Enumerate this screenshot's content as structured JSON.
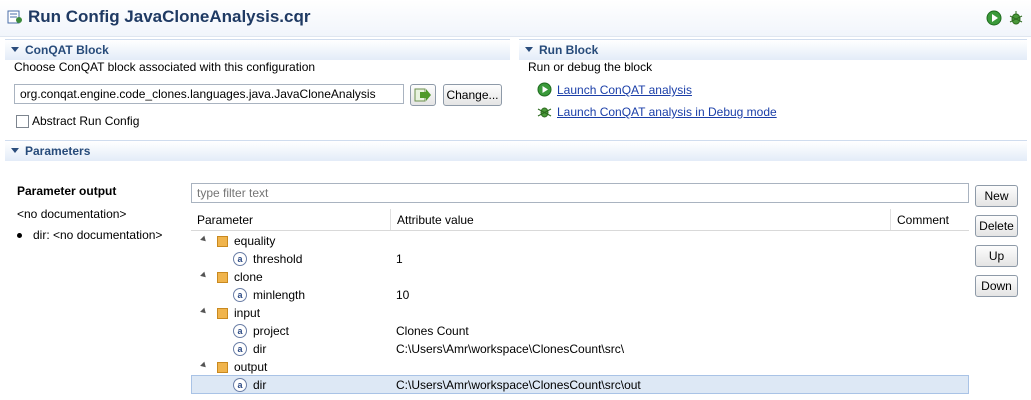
{
  "editor": {
    "title": "Run Config JavaCloneAnalysis.cqr",
    "title_icon": "config-icon",
    "toolbar_icons": [
      "run-icon",
      "debug-icon"
    ]
  },
  "conqat_block": {
    "header": "ConQAT Block",
    "description": "Choose ConQAT block associated with this configuration",
    "block_value": "org.conqat.engine.code_clones.languages.java.JavaCloneAnalysis",
    "go_icon": "arrow-right-icon",
    "change_label": "Change...",
    "abstract_label": "Abstract Run Config"
  },
  "run_block": {
    "header": "Run Block",
    "description": "Run or debug the block",
    "launch_label": "Launch ConQAT analysis",
    "launch_debug_label": "Launch ConQAT analysis in Debug mode"
  },
  "parameters": {
    "header": "Parameters",
    "doc_title": "Parameter output",
    "doc_text": "<no documentation>",
    "doc_bullet": "dir: <no documentation>",
    "filter_placeholder": "type filter text",
    "columns": [
      "Parameter",
      "Attribute value",
      "Comment"
    ],
    "buttons": {
      "new": "New",
      "delete": "Delete",
      "up": "Up",
      "down": "Down"
    },
    "attr_glyph": "a",
    "rows": [
      {
        "name": "equality",
        "value": ""
      },
      {
        "name": "threshold",
        "value": "1"
      },
      {
        "name": "clone",
        "value": ""
      },
      {
        "name": "minlength",
        "value": "10"
      },
      {
        "name": "input",
        "value": ""
      },
      {
        "name": "project",
        "value": "Clones Count"
      },
      {
        "name": "dir",
        "value": "C:\\Users\\Amr\\workspace\\ClonesCount\\src\\"
      },
      {
        "name": "output",
        "value": ""
      },
      {
        "name": "dir",
        "value": "C:\\Users\\Amr\\workspace\\ClonesCount\\src\\out",
        "selected": true
      }
    ]
  },
  "colors": {
    "header_text": "#274b7a",
    "link": "#1a3ea8",
    "selection": "#dde8f5"
  }
}
